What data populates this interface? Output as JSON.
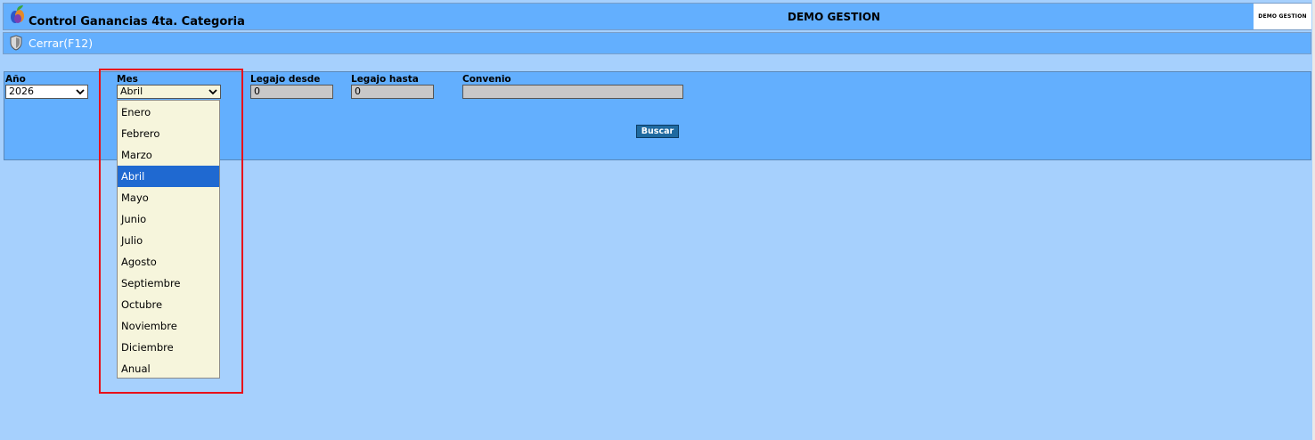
{
  "header": {
    "app_title": "Control Ganancias 4ta. Categoria",
    "company": "DEMO GESTION",
    "logo_text": "DEMO GESTION",
    "app_icon": "app-logo-icon"
  },
  "toolbar": {
    "close_label": "Cerrar(F12)",
    "close_icon": "shield-close-icon"
  },
  "filters": {
    "year": {
      "label": "Año",
      "value": "2026"
    },
    "month": {
      "label": "Mes",
      "value": "Abril",
      "options": [
        "Enero",
        "Febrero",
        "Marzo",
        "Abril",
        "Mayo",
        "Junio",
        "Julio",
        "Agosto",
        "Septiembre",
        "Octubre",
        "Noviembre",
        "Diciembre",
        "Anual"
      ],
      "selected_index": 3
    },
    "legajo_desde": {
      "label": "Legajo desde",
      "value": "0"
    },
    "legajo_hasta": {
      "label": "Legajo hasta",
      "value": "0"
    },
    "convenio": {
      "label": "Convenio",
      "value": ""
    }
  },
  "buttons": {
    "search": "Buscar"
  },
  "colors": {
    "background": "#a6d0fd",
    "panel": "#63affe",
    "selected_option": "#1f69d1",
    "dropdown_bg": "#f6f5dc",
    "highlight": "#e8101a",
    "button": "#1f6aa0"
  }
}
